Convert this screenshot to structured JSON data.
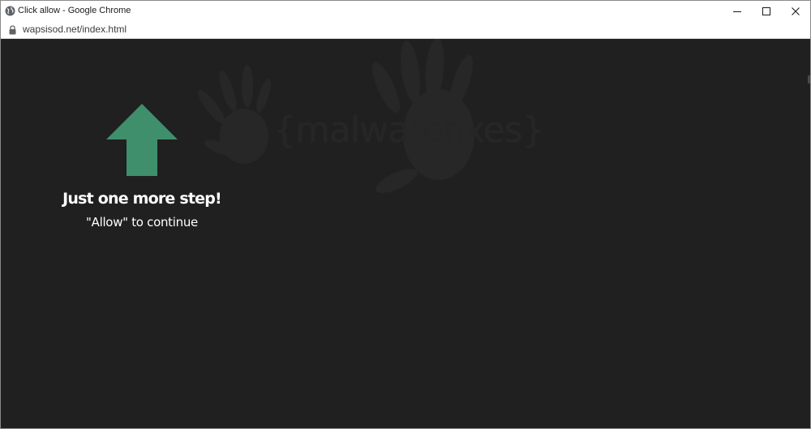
{
  "window": {
    "title": "Click allow - Google Chrome",
    "controls": {
      "minimize_icon": "minimize-icon",
      "maximize_icon": "maximize-icon",
      "close_icon": "close-icon"
    }
  },
  "address_bar": {
    "security_icon": "lock-icon",
    "url": "wapsisod.net/index.html"
  },
  "page": {
    "background_color": "#202020",
    "watermark_text": "{malwarefixes}",
    "arrow": {
      "icon": "up-arrow-icon",
      "color": "#3f8f6c"
    },
    "headline": "Just one more step!",
    "subline": "\"Allow\" to continue"
  }
}
